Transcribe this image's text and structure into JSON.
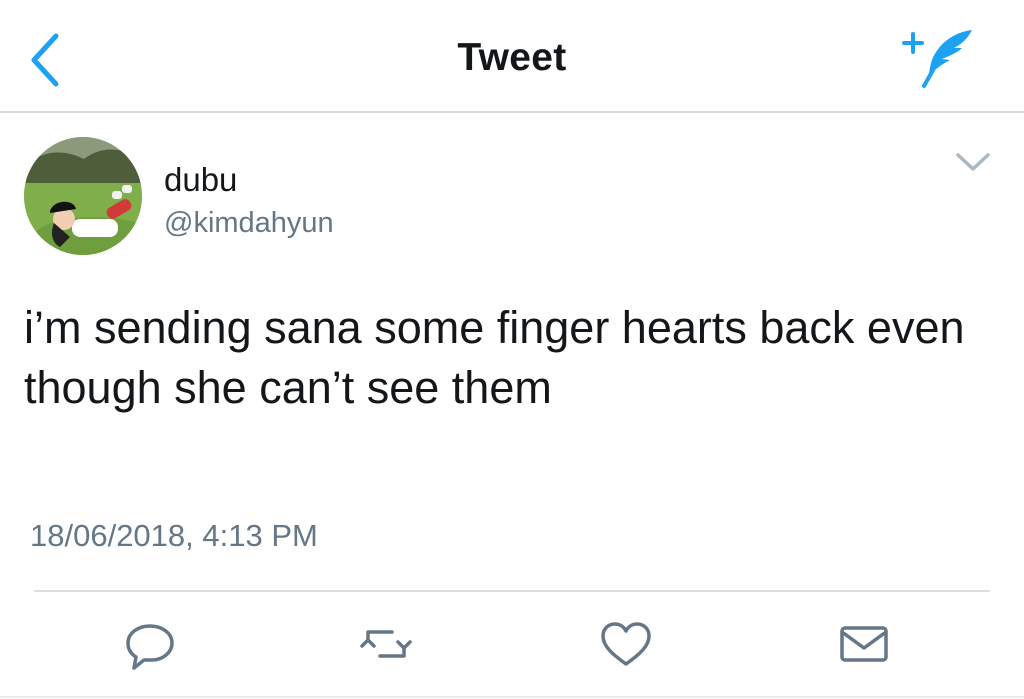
{
  "colors": {
    "accent": "#1da1f2",
    "text_primary": "#14171a",
    "text_secondary": "#657786",
    "divider": "#d9dde1"
  },
  "nav": {
    "title": "Tweet",
    "back_icon": "chevron-left-icon",
    "compose_icon": "compose-tweet-icon"
  },
  "tweet": {
    "author": {
      "display_name": "dubu",
      "handle": "@kimdahyun",
      "avatar_icon": "avatar"
    },
    "menu_icon": "chevron-down-icon",
    "text": "i’m sending sana some finger hearts back even though she can’t see them",
    "timestamp": "18/06/2018, 4:13 PM"
  },
  "actions": [
    {
      "name": "reply",
      "icon": "reply-icon"
    },
    {
      "name": "retweet",
      "icon": "retweet-icon"
    },
    {
      "name": "like",
      "icon": "heart-icon"
    },
    {
      "name": "message",
      "icon": "envelope-icon"
    }
  ]
}
